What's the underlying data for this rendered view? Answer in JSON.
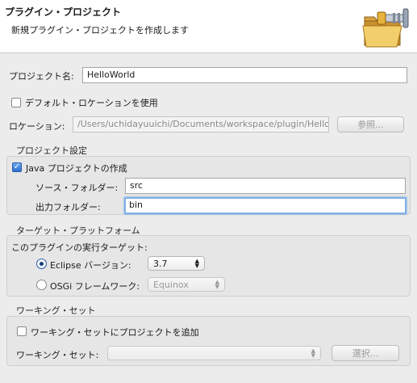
{
  "header": {
    "title": "プラグイン・プロジェクト",
    "description": "新規プラグイン・プロジェクトを作成します",
    "banner_icon": "folder-plug-icon"
  },
  "project": {
    "name_label": "プロジェクト名:",
    "name_value": "HelloWorld",
    "default_location_label": "デフォルト・ロケーションを使用",
    "default_location_checked": true,
    "location_label": "ロケーション:",
    "location_value": "/Users/uchidayuuichi/Documents/workspace/plugin/Hello",
    "browse_label": "参照..."
  },
  "project_settings": {
    "title": "プロジェクト設定",
    "java_project_label": "Java プロジェクトの作成",
    "java_project_checked": true,
    "source_folder_label": "ソース・フォルダー:",
    "source_folder_value": "src",
    "output_folder_label": "出力フォルダー:",
    "output_folder_value": "bin"
  },
  "target_platform": {
    "title": "ターゲット・プラットフォーム",
    "subtitle": "このプラグインの実行ターゲット:",
    "eclipse_label": "Eclipse バージョン:",
    "eclipse_selected": true,
    "eclipse_version": "3.7",
    "osgi_label": "OSGi フレームワーク:",
    "osgi_value": "Equinox"
  },
  "working_sets": {
    "title": "ワーキング・セット",
    "add_label": "ワーキング・セットにプロジェクトを追加",
    "add_checked": false,
    "sets_label": "ワーキング・セット:",
    "sets_value": "",
    "select_label": "選択..."
  },
  "colors": {
    "accent": "#2f6fd0",
    "focus_ring": "#7fb0e6",
    "background": "#ececec"
  }
}
